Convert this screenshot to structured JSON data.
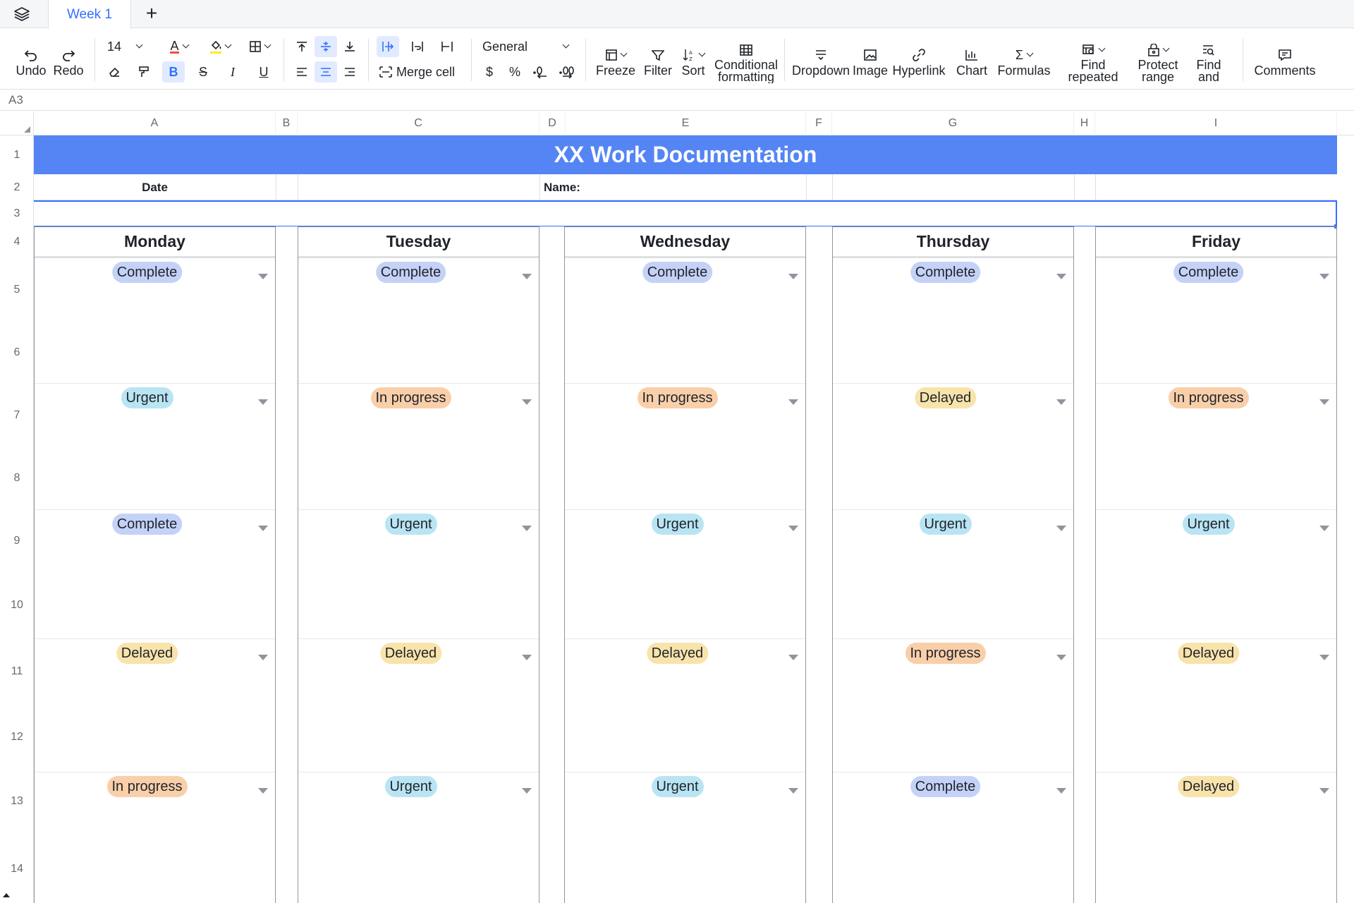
{
  "tabs": {
    "active_label": "Week 1"
  },
  "toolbar": {
    "undo": "Undo",
    "redo": "Redo",
    "font_size": "14",
    "merge_cell": "Merge cell",
    "number_format": "General",
    "currency": "$",
    "percent": "%",
    "freeze": "Freeze",
    "filter": "Filter",
    "sort": "Sort",
    "conditional_formatting": "Conditional formatting",
    "dropdown": "Dropdown",
    "image": "Image",
    "hyperlink": "Hyperlink",
    "chart": "Chart",
    "formulas": "Formulas",
    "find_repeated": "Find repeated",
    "protect_range": "Protect range",
    "find_and": "Find and",
    "comments": "Comments",
    "colors": {
      "font_color": "#f54a45",
      "fill_color": "#ffe928"
    }
  },
  "formula_bar": {
    "cell_ref": "A3"
  },
  "columns": [
    "A",
    "B",
    "C",
    "D",
    "E",
    "F",
    "G",
    "H",
    "I"
  ],
  "rows": [
    "1",
    "2",
    "3",
    "4",
    "5",
    "6",
    "7",
    "8",
    "9",
    "10",
    "11",
    "12",
    "13",
    "14"
  ],
  "sheet": {
    "title": "XX Work Documentation",
    "date_label": "Date",
    "name_label": "Name:",
    "colors": {
      "title_bg": "#5585f5",
      "selection": "#3370ff"
    },
    "days": [
      {
        "name": "Monday",
        "statuses": [
          "Complete",
          "Urgent",
          "Complete",
          "Delayed",
          "In progress"
        ]
      },
      {
        "name": "Tuesday",
        "statuses": [
          "Complete",
          "In progress",
          "Urgent",
          "Delayed",
          "Urgent"
        ]
      },
      {
        "name": "Wednesday",
        "statuses": [
          "Complete",
          "In progress",
          "Urgent",
          "Delayed",
          "Urgent"
        ]
      },
      {
        "name": "Thursday",
        "statuses": [
          "Complete",
          "Delayed",
          "Urgent",
          "In progress",
          "Complete"
        ]
      },
      {
        "name": "Friday",
        "statuses": [
          "Complete",
          "In progress",
          "Urgent",
          "Delayed",
          "Delayed"
        ]
      }
    ],
    "status_colors": {
      "Complete": "#c4d2f7",
      "Urgent": "#b9e4f3",
      "In progress": "#f9cfaa",
      "Delayed": "#f8e3ab"
    }
  }
}
